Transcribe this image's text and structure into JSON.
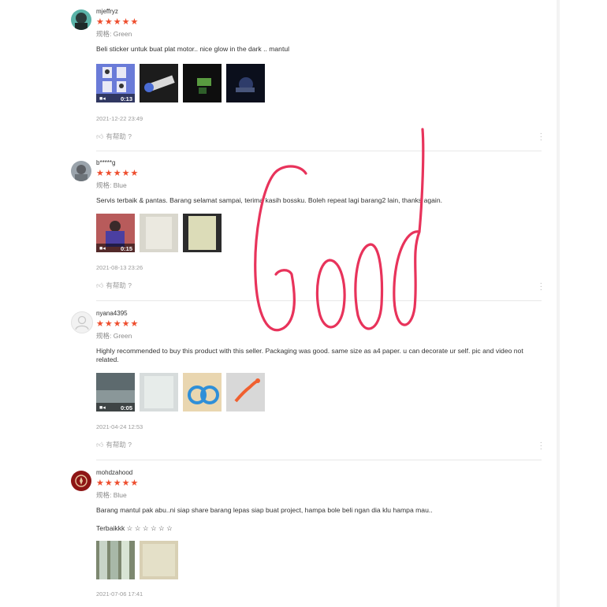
{
  "reviews": [
    {
      "username": "mjeffryz",
      "stars": "★★★★★",
      "variation": "规格: Green",
      "comment": "Beli sticker untuk buat plat motor.. nice glow in the dark .. mantul",
      "video_duration": "0:13",
      "date": "2021-12-22 23:49",
      "helpful": "有帮助 ?"
    },
    {
      "username": "b*****g",
      "stars": "★★★★★",
      "variation": "规格: Blue",
      "comment": "Servis terbaik & pantas. Barang selamat sampai, terima kasih bossku. Boleh repeat lagi barang2 lain, thanks again.",
      "video_duration": "0:15",
      "date": "2021-08-13 23:26",
      "helpful": "有帮助 ?"
    },
    {
      "username": "nyana4395",
      "stars": "★★★★★",
      "variation": "规格: Green",
      "comment": "Highly recommended to buy this product with this seller. Packaging was good. same size as a4 paper. u can decorate ur self. pic and video not related.",
      "video_duration": "0:05",
      "date": "2021-04-24 12:53",
      "helpful": "有帮助 ?"
    },
    {
      "username": "mohdzahood",
      "stars": "★★★★★",
      "variation": "规格: Blue",
      "comment": "Barang mantul pak abu..ni siap share barang lepas siap buat project, hampa bole beli ngan dia klu hampa mau..",
      "comment2": "Terbaikkk ☆ ☆ ☆ ☆ ☆ ☆",
      "date": "2021-07-06 17:41"
    }
  ],
  "overlay_text": "Good",
  "colors": {
    "star": "#ee4d2d",
    "overlay": "#e8335b"
  },
  "icons": {
    "thumb": "thumbs-up-icon",
    "more": "more-vertical-icon",
    "video": "video-camera-icon"
  }
}
